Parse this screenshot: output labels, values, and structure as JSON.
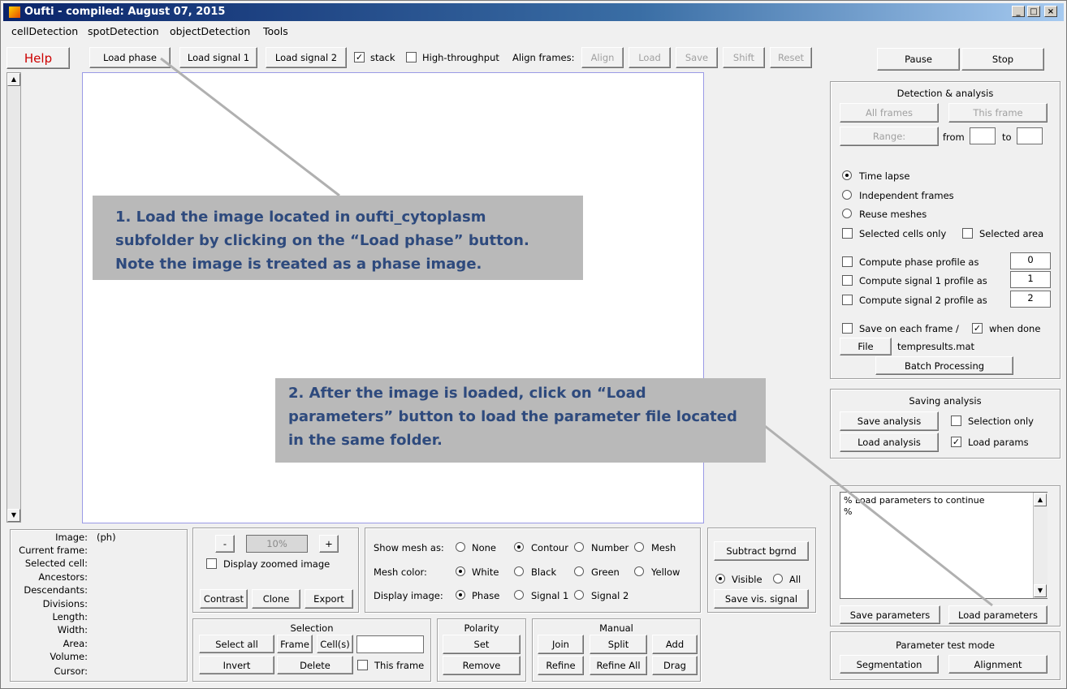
{
  "window": {
    "title": "Oufti - compiled:  August 07, 2015",
    "min": "_",
    "max": "□",
    "close": "×"
  },
  "menu": [
    "cellDetection",
    "spotDetection",
    "objectDetection",
    "Tools"
  ],
  "toolbar": {
    "help": "Help",
    "load_phase": "Load phase",
    "load_signal1": "Load signal 1",
    "load_signal2": "Load signal 2",
    "stack": "stack",
    "high_throughput": "High-throughput",
    "align_frames": "Align frames:",
    "align": "Align",
    "load": "Load",
    "save": "Save",
    "shift": "Shift",
    "reset": "Reset",
    "pause": "Pause",
    "stop": "Stop"
  },
  "detection": {
    "title": "Detection & analysis",
    "all_frames": "All frames",
    "this_frame": "This frame",
    "range": "Range:",
    "from": "from",
    "to": "to",
    "time_lapse": "Time lapse",
    "independent_frames": "Independent frames",
    "reuse_meshes": "Reuse meshes",
    "selected_cells_only": "Selected cells only",
    "selected_area": "Selected area",
    "compute_phase": "Compute phase profile as",
    "compute_signal1": "Compute signal 1 profile as",
    "compute_signal2": "Compute signal 2 profile as",
    "phase_val": "0",
    "signal1_val": "1",
    "signal2_val": "2",
    "save_each_frame": "Save on each frame /",
    "when_done": "when done",
    "file": "File",
    "filename": "tempresults.mat",
    "batch": "Batch Processing"
  },
  "saving": {
    "title": "Saving analysis",
    "save_analysis": "Save analysis",
    "selection_only": "Selection only",
    "load_analysis": "Load analysis",
    "load_params": "Load params"
  },
  "log": {
    "line1": "% Load parameters to continue",
    "line2": "%"
  },
  "params": {
    "save": "Save parameters",
    "load": "Load parameters"
  },
  "test_mode": {
    "title": "Parameter test mode",
    "segmentation": "Segmentation",
    "alignment": "Alignment"
  },
  "info": {
    "labels": [
      "Image:",
      "Current frame:",
      "Selected cell:",
      "Ancestors:",
      "Descendants:",
      "Divisions:",
      "Length:",
      "Width:",
      "Area:",
      "Volume:",
      "Cursor:"
    ],
    "image_value": "(ph)"
  },
  "zoom": {
    "minus": "-",
    "value": "10%",
    "plus": "+",
    "display_zoomed": "Display zoomed image",
    "contrast": "Contrast",
    "clone": "Clone",
    "export": "Export"
  },
  "display": {
    "show_mesh": "Show mesh as:",
    "none": "None",
    "contour": "Contour",
    "number": "Number",
    "mesh": "Mesh",
    "mesh_color": "Mesh color:",
    "white": "White",
    "black": "Black",
    "green": "Green",
    "yellow": "Yellow",
    "display_image": "Display image:",
    "phase": "Phase",
    "signal1": "Signal 1",
    "signal2": "Signal 2"
  },
  "bgrnd": {
    "subtract": "Subtract bgrnd",
    "visible": "Visible",
    "all": "All",
    "save_vis": "Save vis. signal"
  },
  "selection": {
    "title": "Selection",
    "select_all": "Select all",
    "frame": "Frame",
    "cells": "Cell(s)",
    "invert": "Invert",
    "delete": "Delete",
    "this_frame": "This frame"
  },
  "polarity": {
    "title": "Polarity",
    "set": "Set",
    "remove": "Remove"
  },
  "manual": {
    "title": "Manual",
    "join": "Join",
    "split": "Split",
    "add": "Add",
    "refine": "Refine",
    "refine_all": "Refine All",
    "drag": "Drag"
  },
  "notes": {
    "note1": [
      "1.  Load the image located in oufti_cytoplasm",
      "subfolder by clicking on the “Load phase” button.",
      "Note the image is treated as a phase image."
    ],
    "note2": [
      "2.  After the image is loaded, click on “Load",
      "parameters” button to load the parameter file located",
      "in the same folder."
    ]
  },
  "colors": {
    "help_text": "#cc0000",
    "note_text": "#2e4a7d",
    "note_bg": "#b9b9b9",
    "canvas_border": "#9a9ae6"
  }
}
